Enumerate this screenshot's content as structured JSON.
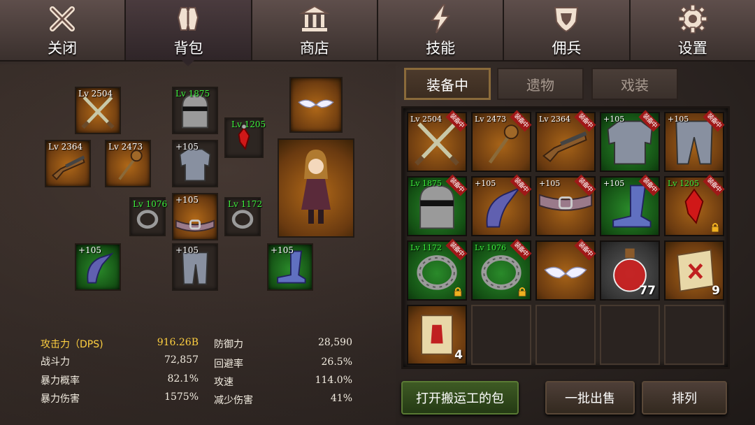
{
  "nav": {
    "items": [
      {
        "label": "关闭",
        "icon": "close-icon"
      },
      {
        "label": "背包",
        "icon": "backpack-icon"
      },
      {
        "label": "商店",
        "icon": "shop-icon"
      },
      {
        "label": "技能",
        "icon": "skill-lightning-icon"
      },
      {
        "label": "佣兵",
        "icon": "mercenary-shield-icon"
      },
      {
        "label": "设置",
        "icon": "gear-icon"
      }
    ],
    "active_index": 1
  },
  "equipped": {
    "weapon_main": {
      "level": "Lv 2504",
      "icon": "crossed-swords-icon"
    },
    "helmet": {
      "level": "Lv 1875",
      "icon": "helmet-icon"
    },
    "amulet": {
      "level": "Lv 1205",
      "icon": "red-gem-amulet-icon"
    },
    "accessory_top": {
      "icon": "winged-mask-icon"
    },
    "weapon_gun": {
      "level": "Lv 2364",
      "icon": "shotgun-icon"
    },
    "weapon_mace": {
      "level": "Lv 2473",
      "icon": "mace-icon"
    },
    "armor": {
      "level": "+105",
      "icon": "chest-armor-icon"
    },
    "ring_left": {
      "level": "Lv 1076",
      "icon": "ring-icon"
    },
    "belt": {
      "level": "+105",
      "icon": "belt-icon"
    },
    "ring_right": {
      "level": "Lv 1172",
      "icon": "ring-icon"
    },
    "gloves": {
      "level": "+105",
      "icon": "claw-gloves-icon"
    },
    "pants": {
      "level": "+105",
      "icon": "leg-armor-icon"
    },
    "boots": {
      "level": "+105",
      "icon": "boots-icon"
    }
  },
  "stats": {
    "attack_label": "攻击力（DPS)",
    "attack_value": "916.26B",
    "power_label": "战斗力",
    "power_value": "72,857",
    "crit_rate_label": "暴力概率",
    "crit_rate_value": "82.1%",
    "crit_dmg_label": "暴力伤害",
    "crit_dmg_value": "1575%",
    "defense_label": "防御力",
    "defense_value": "28,590",
    "evade_label": "回避率",
    "evade_value": "26.5%",
    "atk_speed_label": "攻速",
    "atk_speed_value": "114.0%",
    "dmg_reduce_label": "减少伤害",
    "dmg_reduce_value": "41%"
  },
  "tabs": [
    {
      "label": "装备中"
    },
    {
      "label": "遗物"
    },
    {
      "label": "戏装"
    }
  ],
  "equip_badge_text": "装备中",
  "inventory": [
    {
      "level": "Lv 2504",
      "badge": true,
      "icon": "crossed-swords-icon",
      "bg": "orange"
    },
    {
      "level": "Lv 2473",
      "badge": true,
      "icon": "mace-icon",
      "bg": "orange"
    },
    {
      "level": "Lv 2364",
      "badge": true,
      "icon": "shotgun-icon",
      "bg": "orange"
    },
    {
      "level": "+105",
      "badge": true,
      "icon": "chest-armor-icon",
      "bg": "green"
    },
    {
      "level": "+105",
      "badge": true,
      "icon": "leg-armor-icon",
      "bg": "orange"
    },
    {
      "level": "Lv 1875",
      "badge": true,
      "icon": "helmet-icon",
      "bg": "green",
      "green_level": true
    },
    {
      "level": "+105",
      "badge": true,
      "icon": "claw-gloves-icon",
      "bg": "orange"
    },
    {
      "level": "+105",
      "badge": true,
      "icon": "belt-icon",
      "bg": "orange"
    },
    {
      "level": "+105",
      "badge": true,
      "icon": "boots-icon",
      "bg": "green"
    },
    {
      "level": "Lv 1205",
      "badge": true,
      "icon": "red-gem-amulet-icon",
      "bg": "orange",
      "green_level": true,
      "lock": true
    },
    {
      "level": "Lv 1172",
      "badge": true,
      "icon": "ring-icon",
      "bg": "green",
      "green_level": true,
      "lock": true
    },
    {
      "level": "Lv 1076",
      "badge": true,
      "icon": "ring-icon",
      "bg": "green",
      "green_level": true,
      "lock": true
    },
    {
      "level": "",
      "badge": true,
      "icon": "winged-mask-icon",
      "bg": "orange"
    },
    {
      "level": "",
      "badge": false,
      "icon": "red-potion-icon",
      "bg": "gray",
      "qty": "77"
    },
    {
      "level": "",
      "badge": false,
      "icon": "scroll-icon",
      "bg": "orange",
      "qty": "9"
    },
    {
      "level": "",
      "badge": false,
      "icon": "scroll-red-icon",
      "bg": "orange",
      "qty": "4"
    },
    {
      "empty": true
    },
    {
      "empty": true
    },
    {
      "empty": true
    },
    {
      "empty": true
    }
  ],
  "buttons": {
    "porter_bag": "打开搬运工的包",
    "bulk_sell": "一批出售",
    "sort": "排列"
  }
}
